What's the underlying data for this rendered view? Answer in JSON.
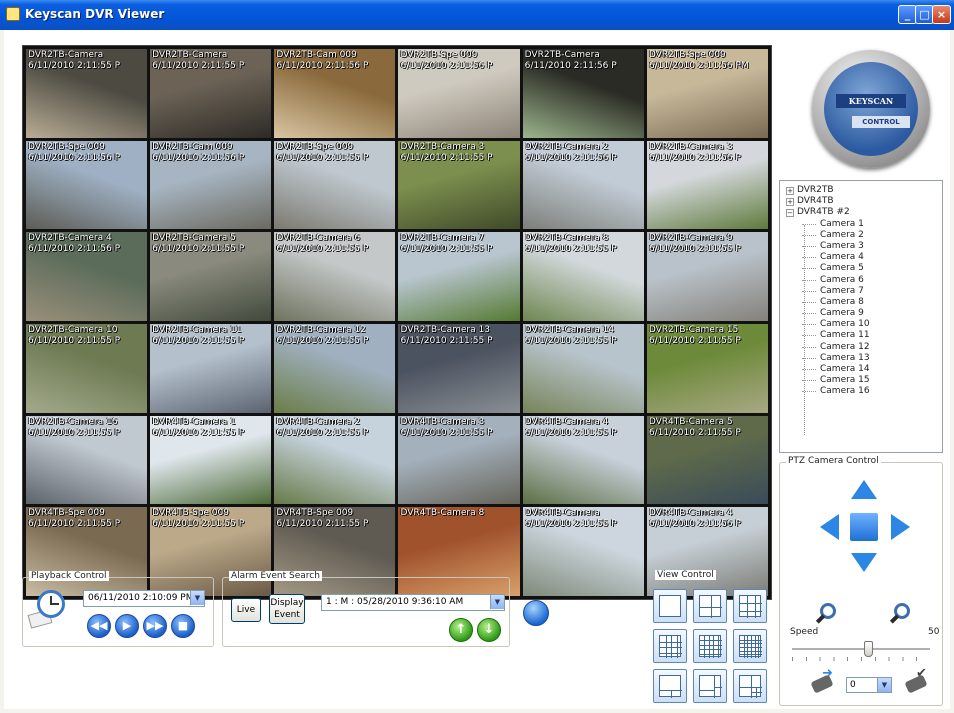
{
  "window": {
    "title": "Keyscan DVR Viewer",
    "controls": [
      "_",
      "□",
      "×"
    ]
  },
  "logo": {
    "top_text": "KEYSCAN",
    "bottom_text": "CONTROL"
  },
  "grid": {
    "columns": 6,
    "cells": [
      {
        "label": "DVR2TB-Camera\n6/11/2010 2:11:55 P",
        "colors": [
          "#4d4a42",
          "#b9ad95"
        ]
      },
      {
        "label": "DVR2TB-Camera\n6/11/2010 2:11:55 P",
        "colors": [
          "#6c6356",
          "#2d2a26"
        ]
      },
      {
        "label": "DVR2TB-Cam 009\n6/11/2010 2:11:56 P",
        "colors": [
          "#8a6a3c",
          "#d9c6a2"
        ]
      },
      {
        "label": "DVR2TB-Spe 009\n6/11/2010 2:11:56 P",
        "colors": [
          "#cfcac0",
          "#8d8478"
        ]
      },
      {
        "label": "DVR2TB-Camera\n6/11/2010 2:11:56 P",
        "colors": [
          "#2a2b24",
          "#9cb58d"
        ]
      },
      {
        "label": "DVR2TB-Spe 009\n6/11/2010 2:11:56 PM",
        "colors": [
          "#c8b89a",
          "#7a6a52"
        ]
      },
      {
        "label": "DVR2TB-Spe 009\n6/11/2010 2:11:56 P",
        "colors": [
          "#9fb0c4",
          "#5b5d55"
        ]
      },
      {
        "label": "DVR2TB-Cam 009\n6/11/2010 2:11:56 P",
        "colors": [
          "#a7b5c2",
          "#6b6a60"
        ]
      },
      {
        "label": "DVR2TB-Spe 009\n6/11/2010 2:11:55 P",
        "colors": [
          "#bfc8cf",
          "#7c7a70"
        ]
      },
      {
        "label": "DVR2TB-Camera 3\n6/11/2010 2:11:55 P",
        "colors": [
          "#7d8f4e",
          "#3f4a2a"
        ]
      },
      {
        "label": "DVR2TB-Camera 2\n6/11/2010 2:11:56 P",
        "colors": [
          "#c2ccd6",
          "#7c7f7a"
        ]
      },
      {
        "label": "DVR2TB-Camera 3\n6/11/2010 2:11:56 P",
        "colors": [
          "#d4d8dc",
          "#5f7a3c"
        ]
      },
      {
        "label": "DVR2TB-Camera 4\n6/11/2010 2:11:56 P",
        "colors": [
          "#5b6c5a",
          "#9a8f7a"
        ]
      },
      {
        "label": "DVR2TB-Camera 5\n6/11/2010 2:11:55 P",
        "colors": [
          "#8a8a7e",
          "#414a3c"
        ]
      },
      {
        "label": "DVR2TB-Camera 6\n6/11/2010 2:11:55 P",
        "colors": [
          "#c4c8c8",
          "#6f735f"
        ]
      },
      {
        "label": "DVR2TB-Camera 7\n6/11/2010 2:11:55 P",
        "colors": [
          "#b9c6d0",
          "#557a32"
        ]
      },
      {
        "label": "DVR2TB-Camera 8\n6/11/2010 2:11:55 P",
        "colors": [
          "#d2d8db",
          "#6e8650"
        ]
      },
      {
        "label": "DVR2TB-Camera 9\n6/11/2010 2:11:55 P",
        "colors": [
          "#b9c2ca",
          "#84817a"
        ]
      },
      {
        "label": "DVR2TB-Camera 10\n6/11/2010 2:11:55 P",
        "colors": [
          "#6d7a52",
          "#a3aa8c"
        ]
      },
      {
        "label": "DVR2TB-Camera 11\n6/11/2010 2:11:55 P",
        "colors": [
          "#b4c0cc",
          "#5b6370"
        ]
      },
      {
        "label": "DVR2TB-Camera 12\n6/11/2010 2:11:55 P",
        "colors": [
          "#a0b0c0",
          "#6a7d47"
        ]
      },
      {
        "label": "DVR2TB-Camera 13\n6/11/2010 2:11:55 P",
        "colors": [
          "#4c5360",
          "#8a8f94"
        ]
      },
      {
        "label": "DVR2TB-Camera 14\n6/11/2010 2:11:55 P",
        "colors": [
          "#b8c4cc",
          "#77845a"
        ]
      },
      {
        "label": "DVR2TB-Camera 15\n6/11/2010 2:11:55 P",
        "colors": [
          "#6d8a3a",
          "#a9a884"
        ]
      },
      {
        "label": "DVR2TB-Camera 16\n6/11/2010 2:11:55 P",
        "colors": [
          "#c0c8d0",
          "#5d636a"
        ]
      },
      {
        "label": "DVR4TB-Camera 1\n6/11/2010 2:11:55 P",
        "colors": [
          "#dfe6ec",
          "#4d6a38"
        ]
      },
      {
        "label": "DVR4TB-Camera 2\n6/11/2010 2:11:55 P",
        "colors": [
          "#c6d2dc",
          "#677a48"
        ]
      },
      {
        "label": "DVR4TB-Camera 3\n6/11/2010 2:11:55 P",
        "colors": [
          "#a4b0bc",
          "#65645a"
        ]
      },
      {
        "label": "DVR4TB-Camera 4\n6/11/2010 2:11:55 P",
        "colors": [
          "#c8d0da",
          "#5c6f45"
        ]
      },
      {
        "label": "DVR4TB-Camera 5\n6/11/2010 2:11:55 P",
        "colors": [
          "#5e6a4a",
          "#3a4a5a"
        ]
      },
      {
        "label": "DVR4TB-Spe 009\n6/11/2010 2:11:55 P",
        "colors": [
          "#7b6a52",
          "#c9bda4"
        ]
      },
      {
        "label": "DVR4TB-Spe 009\n6/11/2010 2:11:55 P",
        "colors": [
          "#bca98a",
          "#6a5a46"
        ]
      },
      {
        "label": "DVR4TB-Spe 009\n6/11/2010 2:11:55 P",
        "colors": [
          "#5f5a52",
          "#a49a86"
        ]
      },
      {
        "label": "DVR4TB-Camera 8",
        "colors": [
          "#a0522d",
          "#d9a06a"
        ]
      },
      {
        "label": "DVR4TB-Camera\n6/11/2010 2:11:55 P",
        "colors": [
          "#cdd6de",
          "#7f8a7a"
        ]
      },
      {
        "label": "DVR4TB-Camera 4\n6/11/2010 2:11:56 P",
        "colors": [
          "#c6cfd6",
          "#7a7b74"
        ]
      }
    ]
  },
  "tree": {
    "roots": [
      {
        "label": "DVR2TB",
        "expand": "+"
      },
      {
        "label": "DVR4TB",
        "expand": "+"
      },
      {
        "label": "DVR4TB #2",
        "expand": "−"
      }
    ],
    "children": [
      "Camera 1",
      "Camera 2",
      "Camera 3",
      "Camera 4",
      "Camera 5",
      "Camera 6",
      "Camera 7",
      "Camera 8",
      "Camera 9",
      "Camera 10",
      "Camera 11",
      "Camera 12",
      "Camera 13",
      "Camera 14",
      "Camera 15",
      "Camera 16"
    ]
  },
  "ptz": {
    "title": "PTZ Camera Control",
    "speed_label": "Speed",
    "speed_max": "50",
    "speed_value_fraction": 0.55,
    "preset_value": "0"
  },
  "playback": {
    "title": "Playback Control",
    "datetime": "06/11/2010  2:10:09 PM",
    "rewind": "◀◀",
    "play": "▶",
    "forward": "▶▶",
    "stop": "■"
  },
  "alarm": {
    "title": "Alarm Event Search",
    "live_label": "Live",
    "display_event_label": "Display Event",
    "event_value": "1 : M : 05/28/2010 9:36:10 AM",
    "up": "↑",
    "down": "↓"
  },
  "view_control": {
    "title": "View Control",
    "layouts": [
      "1x1",
      "2x2",
      "3x3",
      "4x4",
      "5x5",
      "6x6",
      "1+5",
      "1+7",
      "1+12"
    ]
  },
  "icons": {
    "zoom_in": "zoom-in-icon",
    "zoom_out": "zoom-out-icon",
    "dropdown": "▼"
  }
}
